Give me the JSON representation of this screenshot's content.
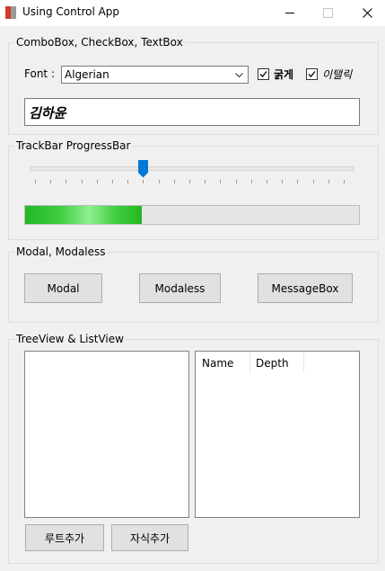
{
  "window": {
    "title": "Using Control App"
  },
  "group1": {
    "legend": "ComboBox, CheckBox, TextBox",
    "font_label": "Font :",
    "font_select": {
      "selected": "Algerian"
    },
    "bold": {
      "label": "굵게",
      "checked": true
    },
    "italic": {
      "label": "이탤릭",
      "checked": true
    },
    "textbox_value": "김하윤"
  },
  "group2": {
    "legend": "TrackBar  ProgressBar",
    "trackbar_value_fraction": 0.35,
    "progress_fraction": 0.35,
    "progress_color": "#22b822"
  },
  "group3": {
    "legend": "Modal, Modaless",
    "buttons": [
      "Modal",
      "Modaless",
      "MessageBox"
    ]
  },
  "group4": {
    "legend": "TreeView & ListView",
    "list_columns": [
      "Name",
      "Depth"
    ],
    "add_root_label": "루트추가",
    "add_child_label": "자식추가"
  },
  "colors": {
    "accent": "#0078d7"
  }
}
